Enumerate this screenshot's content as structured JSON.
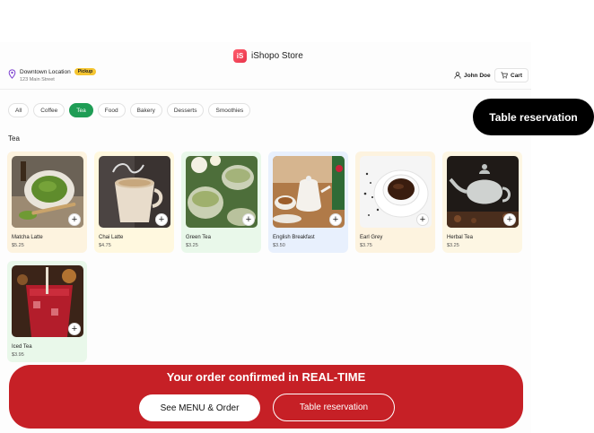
{
  "brand": {
    "logo_text": "iS",
    "name": "iShopo Store"
  },
  "location": {
    "name": "Downtown Location",
    "badge": "Pickup",
    "address": "123 Main Street"
  },
  "user": {
    "name": "John Doe"
  },
  "cart": {
    "label": "Cart"
  },
  "categories": [
    "All",
    "Coffee",
    "Tea",
    "Food",
    "Bakery",
    "Desserts",
    "Smoothies"
  ],
  "active_category": "Tea",
  "section_title": "Tea",
  "products": [
    {
      "name": "Matcha Latte",
      "price": "$5.25",
      "bg": "#fdf3df"
    },
    {
      "name": "Chai Latte",
      "price": "$4.75",
      "bg": "#fff8df"
    },
    {
      "name": "Green Tea",
      "price": "$3.25",
      "bg": "#e9f8ea"
    },
    {
      "name": "English Breakfast",
      "price": "$3.50",
      "bg": "#e8f0fd"
    },
    {
      "name": "Earl Grey",
      "price": "$3.75",
      "bg": "#fdf3df"
    },
    {
      "name": "Herbal Tea",
      "price": "$3.25",
      "bg": "#fdf6e3"
    },
    {
      "name": "Iced Tea",
      "price": "$3.95",
      "bg": "#e9f8ea"
    }
  ],
  "add_symbol": "+",
  "floating_button": "Table reservation",
  "banner": {
    "title": "Your order confirmed in REAL-TIME",
    "menu_button": "See MENU & Order",
    "table_button": "Table reservation",
    "color": "#c62026"
  },
  "colors": {
    "accent_green": "#1f9d55",
    "pickup_badge": "#f5c531"
  }
}
